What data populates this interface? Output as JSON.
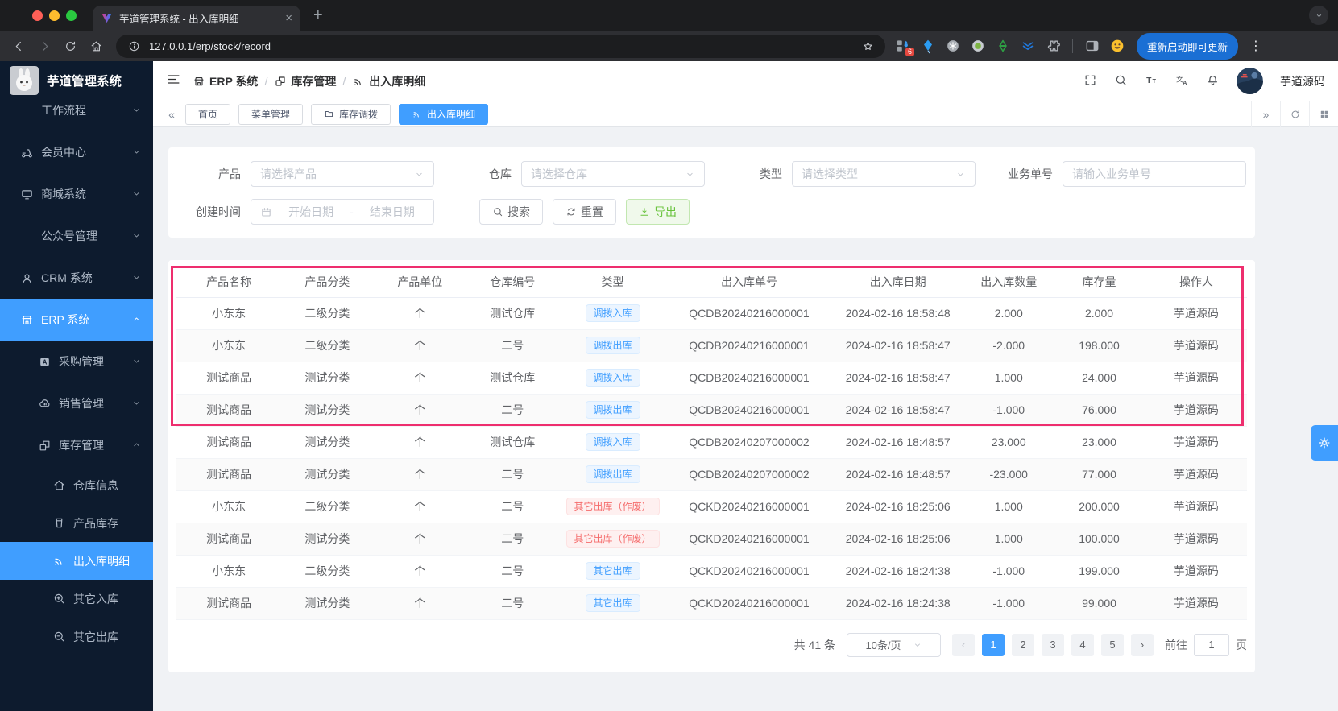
{
  "colors": {
    "accent": "#409eff",
    "annotation": "#ee2e6e",
    "badge_blue": "#409eff",
    "badge_red": "#f56c6c",
    "success_green": "#67c23a"
  },
  "browser": {
    "tab_title": "芋道管理系统 - 出入库明细",
    "url": "127.0.0.1/erp/stock/record",
    "extension_badge": "6",
    "update_button": "重新启动即可更新"
  },
  "app_header": {
    "logo_title": "芋道管理系统",
    "breadcrumb": [
      {
        "icon": "store",
        "label": "ERP 系统"
      },
      {
        "icon": "boxes",
        "label": "库存管理"
      },
      {
        "icon": "signal",
        "label": "出入库明细"
      }
    ],
    "username": "芋道源码"
  },
  "sidebar": {
    "items": [
      {
        "id": "workflow",
        "label": "工作流程",
        "chevron": "down",
        "level": 1
      },
      {
        "id": "member",
        "icon": "scooter",
        "label": "会员中心",
        "chevron": "down",
        "level": 1
      },
      {
        "id": "mall",
        "icon": "monitor",
        "label": "商城系统",
        "chevron": "down",
        "level": 1
      },
      {
        "id": "wechat-mp",
        "label": "公众号管理",
        "chevron": "down",
        "level": 1
      },
      {
        "id": "crm",
        "icon": "user",
        "label": "CRM 系统",
        "chevron": "down",
        "level": 1
      },
      {
        "id": "erp",
        "icon": "store",
        "label": "ERP 系统",
        "chevron": "up",
        "level": 1,
        "active": true
      },
      {
        "id": "purchase",
        "icon": "purchase",
        "label": "采购管理",
        "chevron": "down",
        "level": 2
      },
      {
        "id": "sales",
        "icon": "cloud",
        "label": "销售管理",
        "chevron": "down",
        "level": 2
      },
      {
        "id": "stock",
        "icon": "boxes",
        "label": "库存管理",
        "chevron": "up",
        "level": 2
      },
      {
        "id": "warehouse-info",
        "icon": "house",
        "label": "仓库信息",
        "level": 3
      },
      {
        "id": "product-stock",
        "icon": "cup",
        "label": "产品库存",
        "level": 3
      },
      {
        "id": "stock-record",
        "icon": "signal",
        "label": "出入库明细",
        "level": 3,
        "active": true
      },
      {
        "id": "other-in",
        "icon": "zoomin",
        "label": "其它入库",
        "level": 3
      },
      {
        "id": "other-out",
        "icon": "zoomout",
        "label": "其它出库",
        "level": 3
      }
    ]
  },
  "page_tabs": [
    {
      "label": "首页"
    },
    {
      "label": "菜单管理"
    },
    {
      "label": "库存调拨",
      "icon": "folder"
    },
    {
      "label": "出入库明细",
      "icon": "signal",
      "active": true
    }
  ],
  "filters": {
    "product": {
      "label": "产品",
      "placeholder": "请选择产品"
    },
    "warehouse": {
      "label": "仓库",
      "placeholder": "请选择仓库"
    },
    "type": {
      "label": "类型",
      "placeholder": "请选择类型"
    },
    "biz_no": {
      "label": "业务单号",
      "placeholder": "请输入业务单号"
    },
    "create_time": {
      "label": "创建时间",
      "start_placeholder": "开始日期",
      "separator": "-",
      "end_placeholder": "结束日期"
    },
    "search_button": "搜索",
    "reset_button": "重置",
    "export_button": "导出"
  },
  "table": {
    "columns": [
      "产品名称",
      "产品分类",
      "产品单位",
      "仓库编号",
      "类型",
      "出入库单号",
      "出入库日期",
      "出入库数量",
      "库存量",
      "操作人"
    ],
    "rows": [
      {
        "product": "小东东",
        "category": "二级分类",
        "unit": "个",
        "warehouse": "测试仓库",
        "type": {
          "text": "调拨入库",
          "color": "blue"
        },
        "order_no": "QCDB20240216000001",
        "date": "2024-02-16 18:58:48",
        "qty": "2.000",
        "stock": "2.000",
        "operator": "芋道源码"
      },
      {
        "product": "小东东",
        "category": "二级分类",
        "unit": "个",
        "warehouse": "二号",
        "type": {
          "text": "调拨出库",
          "color": "blue"
        },
        "order_no": "QCDB20240216000001",
        "date": "2024-02-16 18:58:47",
        "qty": "-2.000",
        "stock": "198.000",
        "operator": "芋道源码"
      },
      {
        "product": "测试商品",
        "category": "测试分类",
        "unit": "个",
        "warehouse": "测试仓库",
        "type": {
          "text": "调拨入库",
          "color": "blue"
        },
        "order_no": "QCDB20240216000001",
        "date": "2024-02-16 18:58:47",
        "qty": "1.000",
        "stock": "24.000",
        "operator": "芋道源码"
      },
      {
        "product": "测试商品",
        "category": "测试分类",
        "unit": "个",
        "warehouse": "二号",
        "type": {
          "text": "调拨出库",
          "color": "blue"
        },
        "order_no": "QCDB20240216000001",
        "date": "2024-02-16 18:58:47",
        "qty": "-1.000",
        "stock": "76.000",
        "operator": "芋道源码"
      },
      {
        "product": "测试商品",
        "category": "测试分类",
        "unit": "个",
        "warehouse": "测试仓库",
        "type": {
          "text": "调拨入库",
          "color": "blue"
        },
        "order_no": "QCDB20240207000002",
        "date": "2024-02-16 18:48:57",
        "qty": "23.000",
        "stock": "23.000",
        "operator": "芋道源码"
      },
      {
        "product": "测试商品",
        "category": "测试分类",
        "unit": "个",
        "warehouse": "二号",
        "type": {
          "text": "调拨出库",
          "color": "blue"
        },
        "order_no": "QCDB20240207000002",
        "date": "2024-02-16 18:48:57",
        "qty": "-23.000",
        "stock": "77.000",
        "operator": "芋道源码"
      },
      {
        "product": "小东东",
        "category": "二级分类",
        "unit": "个",
        "warehouse": "二号",
        "type": {
          "text": "其它出库（作废）",
          "color": "red"
        },
        "order_no": "QCKD20240216000001",
        "date": "2024-02-16 18:25:06",
        "qty": "1.000",
        "stock": "200.000",
        "operator": "芋道源码"
      },
      {
        "product": "测试商品",
        "category": "测试分类",
        "unit": "个",
        "warehouse": "二号",
        "type": {
          "text": "其它出库（作废）",
          "color": "red"
        },
        "order_no": "QCKD20240216000001",
        "date": "2024-02-16 18:25:06",
        "qty": "1.000",
        "stock": "100.000",
        "operator": "芋道源码"
      },
      {
        "product": "小东东",
        "category": "二级分类",
        "unit": "个",
        "warehouse": "二号",
        "type": {
          "text": "其它出库",
          "color": "blue"
        },
        "order_no": "QCKD20240216000001",
        "date": "2024-02-16 18:24:38",
        "qty": "-1.000",
        "stock": "199.000",
        "operator": "芋道源码"
      },
      {
        "product": "测试商品",
        "category": "测试分类",
        "unit": "个",
        "warehouse": "二号",
        "type": {
          "text": "其它出库",
          "color": "blue"
        },
        "order_no": "QCKD20240216000001",
        "date": "2024-02-16 18:24:38",
        "qty": "-1.000",
        "stock": "99.000",
        "operator": "芋道源码"
      }
    ]
  },
  "pagination": {
    "total": "共 41 条",
    "page_size": "10条/页",
    "pages": [
      "1",
      "2",
      "3",
      "4",
      "5"
    ],
    "current": "1",
    "goto_label": "前往",
    "goto_value": "1",
    "page_label": "页"
  }
}
